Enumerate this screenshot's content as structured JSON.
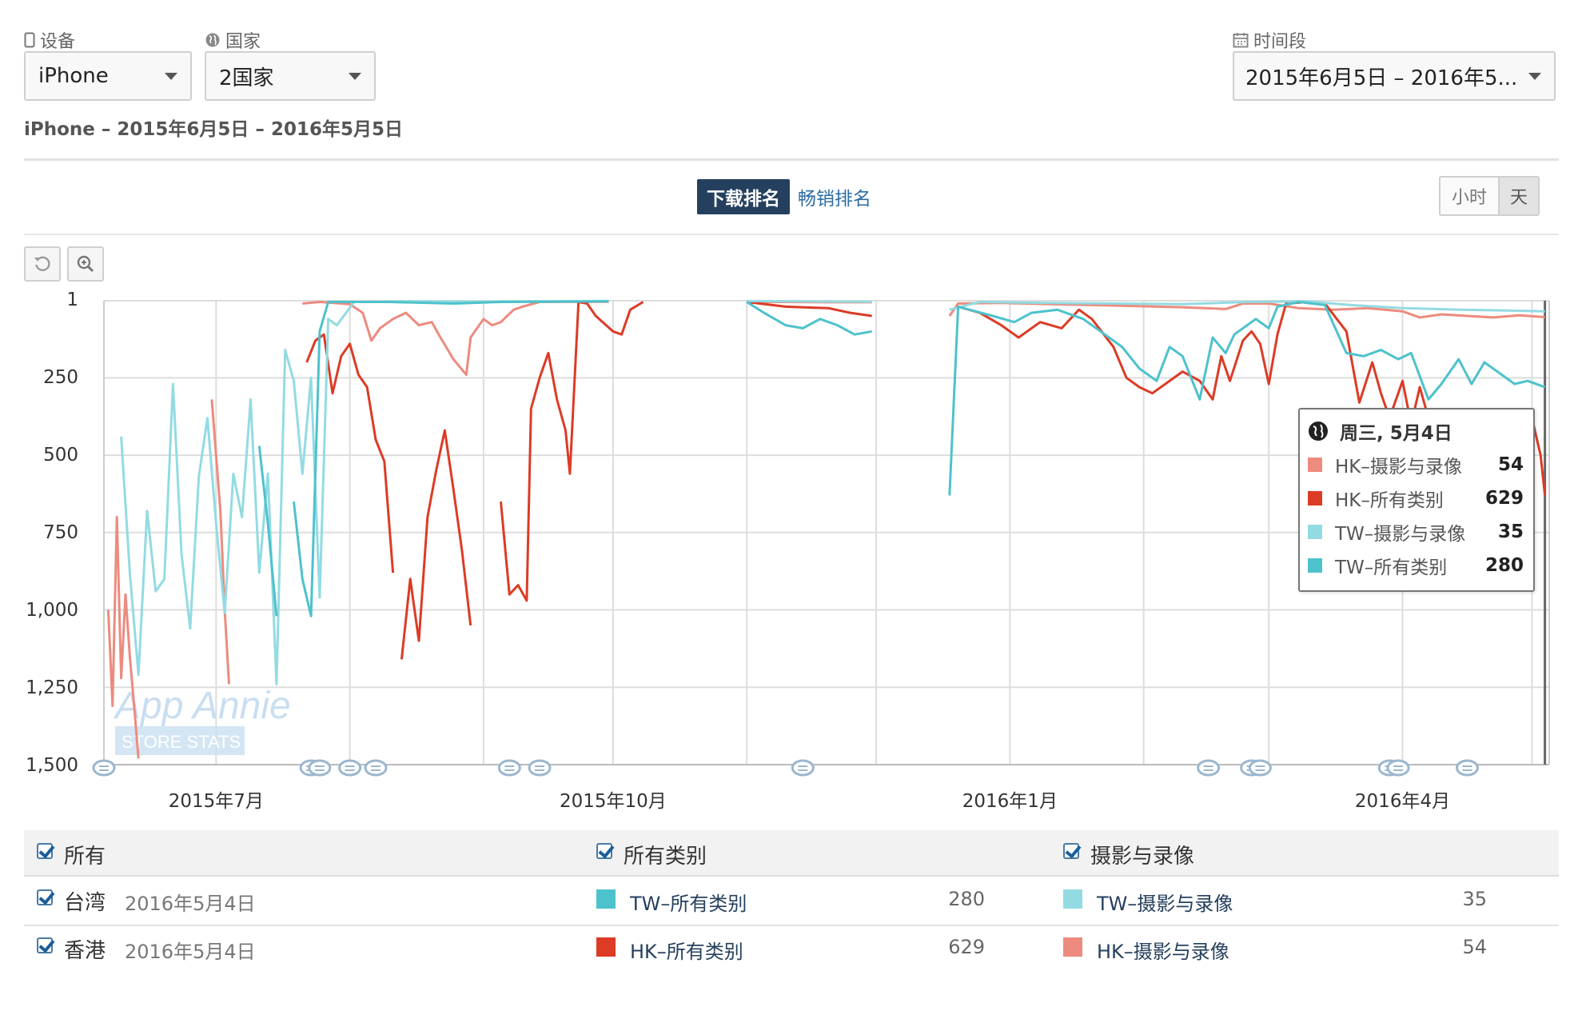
{
  "filters": {
    "device_label": "设备",
    "device_value": "iPhone",
    "country_label": "国家",
    "country_value": "2国家",
    "period_label": "时间段",
    "period_value": "2015年6月5日 – 2016年5..."
  },
  "subtitle": "iPhone – 2015年6月5日 – 2016年5月5日",
  "tabs": {
    "active": "下载排名",
    "other": "畅销排名"
  },
  "granularity": {
    "hour": "小时",
    "day": "天"
  },
  "watermark": {
    "line1": "App Annie",
    "line2": "STORE STATS"
  },
  "colors": {
    "hk_photo": "#ec8b7e",
    "hk_all": "#dc3b26",
    "tw_photo": "#93dbe2",
    "tw_all": "#4dc2cc"
  },
  "icons": {
    "device": "phone-icon",
    "country": "globe-icon",
    "period": "calendar-icon",
    "reset": "reset-icon",
    "zoom": "zoom-in-icon",
    "tooltip": "globe-icon",
    "annotation": "comment-bubble-icon"
  },
  "tooltip": {
    "date": "周三, 5月4日",
    "rows": [
      {
        "name": "HK–摄影与录像",
        "value": "54",
        "color": "#ec8b7e"
      },
      {
        "name": "HK–所有类别",
        "value": "629",
        "color": "#dc3b26"
      },
      {
        "name": "TW–摄影与录像",
        "value": "35",
        "color": "#93dbe2"
      },
      {
        "name": "TW–所有类别",
        "value": "280",
        "color": "#4dc2cc"
      }
    ]
  },
  "legend": {
    "all": "所有",
    "all_categories": "所有类别",
    "photo_video": "摄影与录像",
    "rows": [
      {
        "country": "台湾",
        "date": "2016年5月4日",
        "all_name": "TW–所有类别",
        "all_value": "280",
        "all_color": "#4dc2cc",
        "photo_name": "TW–摄影与录像",
        "photo_value": "35",
        "photo_color": "#93dbe2"
      },
      {
        "country": "香港",
        "date": "2016年5月4日",
        "all_name": "HK–所有类别",
        "all_value": "629",
        "all_color": "#dc3b26",
        "photo_name": "HK–摄影与录像",
        "photo_value": "54",
        "photo_color": "#ec8b7e"
      }
    ]
  },
  "chart_data": {
    "type": "line",
    "title": "",
    "xlabel": "",
    "ylabel": "",
    "y_reversed": true,
    "ylim": [
      1,
      1500
    ],
    "yticks": [
      1,
      250,
      500,
      750,
      1000,
      1250,
      1500
    ],
    "ytick_labels": [
      "1",
      "250",
      "500",
      "750",
      "1,000",
      "1,250",
      "1,500"
    ],
    "xlim": [
      "2015-06-05",
      "2016-05-05"
    ],
    "xticks": [
      {
        "date": "2015-07-01",
        "label": "2015年7月"
      },
      {
        "date": "2015-10-01",
        "label": "2015年10月"
      },
      {
        "date": "2016-01-01",
        "label": "2016年1月"
      },
      {
        "date": "2016-04-01",
        "label": "2016年4月"
      }
    ],
    "grid": true,
    "annotation_dates": [
      "2015-06-05",
      "2015-07-23",
      "2015-07-25",
      "2015-08-01",
      "2015-08-07",
      "2015-09-07",
      "2015-09-14",
      "2015-11-14",
      "2016-02-16",
      "2016-02-26",
      "2016-02-28",
      "2016-03-29",
      "2016-03-31",
      "2016-04-16"
    ],
    "series": [
      {
        "name": "HK–摄影与录像",
        "color": "#ec8b7e",
        "points": [
          [
            "2015-06-06",
            1000
          ],
          [
            "2015-06-07",
            1310
          ],
          [
            "2015-06-08",
            700
          ],
          [
            "2015-06-09",
            1220
          ],
          [
            "2015-06-10",
            950
          ],
          [
            "2015-06-11",
            1150
          ],
          [
            "2015-06-12",
            1310
          ],
          [
            "2015-06-13",
            1480
          ],
          null,
          [
            "2015-06-30",
            320
          ],
          [
            "2015-07-02",
            680
          ],
          [
            "2015-07-03",
            1000
          ],
          [
            "2015-07-04",
            1240
          ],
          null,
          [
            "2015-07-21",
            10
          ],
          [
            "2015-07-25",
            5
          ],
          [
            "2015-08-01",
            12
          ],
          [
            "2015-08-04",
            40
          ],
          [
            "2015-08-06",
            130
          ],
          [
            "2015-08-08",
            90
          ],
          [
            "2015-08-11",
            60
          ],
          [
            "2015-08-14",
            40
          ],
          [
            "2015-08-17",
            80
          ],
          [
            "2015-08-20",
            70
          ],
          [
            "2015-08-22",
            120
          ],
          [
            "2015-08-25",
            190
          ],
          [
            "2015-08-28",
            240
          ],
          [
            "2015-08-29",
            120
          ],
          [
            "2015-09-01",
            60
          ],
          [
            "2015-09-03",
            80
          ],
          [
            "2015-09-05",
            70
          ],
          [
            "2015-09-08",
            30
          ],
          [
            "2015-09-10",
            20
          ],
          [
            "2015-09-14",
            5
          ],
          [
            "2015-09-30",
            4
          ],
          null,
          [
            "2015-11-01",
            5
          ],
          [
            "2015-11-10",
            5
          ],
          [
            "2015-11-20",
            6
          ],
          [
            "2015-11-30",
            6
          ],
          null,
          [
            "2015-12-18",
            50
          ],
          [
            "2015-12-20",
            10
          ],
          [
            "2015-12-30",
            8
          ],
          [
            "2016-01-10",
            12
          ],
          [
            "2016-01-20",
            15
          ],
          [
            "2016-01-30",
            18
          ],
          [
            "2016-02-10",
            22
          ],
          [
            "2016-02-20",
            28
          ],
          [
            "2016-02-24",
            10
          ],
          [
            "2016-03-01",
            10
          ],
          [
            "2016-03-08",
            25
          ],
          [
            "2016-03-16",
            30
          ],
          [
            "2016-03-24",
            25
          ],
          [
            "2016-04-01",
            35
          ],
          [
            "2016-04-05",
            55
          ],
          [
            "2016-04-10",
            45
          ],
          [
            "2016-04-16",
            50
          ],
          [
            "2016-04-22",
            55
          ],
          [
            "2016-04-28",
            48
          ],
          [
            "2016-05-04",
            54
          ]
        ]
      },
      {
        "name": "HK–所有类别",
        "color": "#dc3b26",
        "points": [
          [
            "2015-07-22",
            200
          ],
          [
            "2015-07-24",
            130
          ],
          [
            "2015-07-26",
            110
          ],
          [
            "2015-07-28",
            300
          ],
          [
            "2015-07-30",
            180
          ],
          [
            "2015-08-01",
            140
          ],
          [
            "2015-08-03",
            240
          ],
          [
            "2015-08-05",
            280
          ],
          [
            "2015-08-07",
            450
          ],
          [
            "2015-08-09",
            520
          ],
          [
            "2015-08-11",
            880
          ],
          null,
          [
            "2015-08-13",
            1160
          ],
          [
            "2015-08-15",
            900
          ],
          [
            "2015-08-17",
            1100
          ],
          [
            "2015-08-19",
            700
          ],
          [
            "2015-08-21",
            550
          ],
          [
            "2015-08-23",
            420
          ],
          [
            "2015-08-25",
            610
          ],
          [
            "2015-08-27",
            810
          ],
          [
            "2015-08-29",
            1050
          ],
          null,
          [
            "2015-09-05",
            650
          ],
          [
            "2015-09-07",
            950
          ],
          [
            "2015-09-09",
            920
          ],
          [
            "2015-09-11",
            970
          ],
          [
            "2015-09-12",
            350
          ],
          [
            "2015-09-14",
            250
          ],
          [
            "2015-09-16",
            170
          ],
          [
            "2015-09-18",
            320
          ],
          [
            "2015-09-20",
            420
          ],
          [
            "2015-09-21",
            560
          ],
          [
            "2015-09-23",
            5
          ],
          [
            "2015-09-25",
            10
          ],
          [
            "2015-09-27",
            50
          ],
          [
            "2015-10-01",
            100
          ],
          [
            "2015-10-03",
            110
          ],
          [
            "2015-10-05",
            30
          ],
          [
            "2015-10-08",
            5
          ],
          null,
          [
            "2015-11-01",
            5
          ],
          [
            "2015-11-10",
            20
          ],
          [
            "2015-11-20",
            25
          ],
          [
            "2015-11-25",
            40
          ],
          [
            "2015-11-30",
            50
          ],
          null,
          [
            "2015-12-20",
            20
          ],
          [
            "2015-12-25",
            40
          ],
          [
            "2015-12-30",
            80
          ],
          [
            "2016-01-03",
            120
          ],
          [
            "2016-01-08",
            70
          ],
          [
            "2016-01-13",
            90
          ],
          [
            "2016-01-17",
            30
          ],
          [
            "2016-01-20",
            60
          ],
          [
            "2016-01-25",
            150
          ],
          [
            "2016-01-28",
            250
          ],
          [
            "2016-01-31",
            280
          ],
          [
            "2016-02-03",
            300
          ],
          [
            "2016-02-06",
            270
          ],
          [
            "2016-02-10",
            230
          ],
          [
            "2016-02-14",
            260
          ],
          [
            "2016-02-17",
            320
          ],
          [
            "2016-02-19",
            180
          ],
          [
            "2016-02-21",
            260
          ],
          [
            "2016-02-24",
            130
          ],
          [
            "2016-02-26",
            100
          ],
          [
            "2016-02-28",
            140
          ],
          [
            "2016-03-01",
            270
          ],
          [
            "2016-03-03",
            110
          ],
          [
            "2016-03-05",
            10
          ],
          [
            "2016-03-10",
            5
          ],
          [
            "2016-03-14",
            10
          ],
          [
            "2016-03-19",
            100
          ],
          [
            "2016-03-22",
            330
          ],
          [
            "2016-03-25",
            200
          ],
          [
            "2016-03-27",
            300
          ],
          [
            "2016-03-29",
            380
          ],
          [
            "2016-04-01",
            260
          ],
          [
            "2016-04-03",
            400
          ],
          [
            "2016-04-05",
            280
          ],
          [
            "2016-04-07",
            380
          ],
          null,
          [
            "2016-04-29",
            420
          ],
          [
            "2016-05-01",
            380
          ],
          [
            "2016-05-03",
            500
          ],
          [
            "2016-05-04",
            629
          ]
        ]
      },
      {
        "name": "TW–摄影与录像",
        "color": "#93dbe2",
        "points": [
          [
            "2015-06-09",
            440
          ],
          [
            "2015-06-11",
            880
          ],
          [
            "2015-06-13",
            1210
          ],
          [
            "2015-06-15",
            680
          ],
          [
            "2015-06-17",
            940
          ],
          [
            "2015-06-19",
            900
          ],
          [
            "2015-06-21",
            270
          ],
          [
            "2015-06-23",
            820
          ],
          [
            "2015-06-25",
            1060
          ],
          [
            "2015-06-27",
            570
          ],
          [
            "2015-06-29",
            380
          ],
          [
            "2015-07-01",
            720
          ],
          [
            "2015-07-03",
            1010
          ],
          [
            "2015-07-05",
            560
          ],
          [
            "2015-07-07",
            700
          ],
          [
            "2015-07-09",
            320
          ],
          [
            "2015-07-11",
            880
          ],
          [
            "2015-07-13",
            560
          ],
          [
            "2015-07-15",
            1240
          ],
          [
            "2015-07-17",
            160
          ],
          [
            "2015-07-19",
            260
          ],
          [
            "2015-07-21",
            560
          ],
          [
            "2015-07-23",
            250
          ],
          [
            "2015-07-25",
            960
          ],
          [
            "2015-07-27",
            60
          ],
          [
            "2015-07-29",
            80
          ],
          [
            "2015-08-02",
            5
          ],
          [
            "2015-08-15",
            3
          ],
          [
            "2015-09-01",
            4
          ],
          [
            "2015-09-30",
            2
          ],
          null,
          [
            "2015-11-01",
            2
          ],
          [
            "2015-11-15",
            3
          ],
          [
            "2015-11-30",
            4
          ],
          null,
          [
            "2015-12-18",
            30
          ],
          [
            "2015-12-25",
            5
          ],
          [
            "2016-01-10",
            8
          ],
          [
            "2016-02-10",
            12
          ],
          [
            "2016-02-25",
            5
          ],
          [
            "2016-03-10",
            3
          ],
          [
            "2016-03-20",
            15
          ],
          [
            "2016-04-01",
            25
          ],
          [
            "2016-04-15",
            30
          ],
          [
            "2016-05-04",
            35
          ]
        ]
      },
      {
        "name": "TW–所有类别",
        "color": "#4dc2cc",
        "points": [
          [
            "2015-07-11",
            470
          ],
          [
            "2015-07-13",
            720
          ],
          [
            "2015-07-15",
            1020
          ],
          null,
          [
            "2015-07-19",
            650
          ],
          [
            "2015-07-21",
            900
          ],
          [
            "2015-07-23",
            1020
          ],
          [
            "2015-07-25",
            100
          ],
          [
            "2015-07-27",
            5
          ],
          [
            "2015-08-10",
            5
          ],
          [
            "2015-08-25",
            10
          ],
          [
            "2015-09-05",
            5
          ],
          [
            "2015-09-30",
            3
          ],
          null,
          [
            "2015-11-01",
            5
          ],
          [
            "2015-11-05",
            40
          ],
          [
            "2015-11-10",
            80
          ],
          [
            "2015-11-14",
            90
          ],
          [
            "2015-11-18",
            60
          ],
          [
            "2015-11-22",
            80
          ],
          [
            "2015-11-26",
            110
          ],
          [
            "2015-11-30",
            100
          ],
          null,
          [
            "2015-12-18",
            630
          ],
          [
            "2015-12-20",
            20
          ],
          [
            "2015-12-28",
            50
          ],
          [
            "2016-01-02",
            70
          ],
          [
            "2016-01-06",
            40
          ],
          [
            "2016-01-12",
            30
          ],
          [
            "2016-01-18",
            60
          ],
          [
            "2016-01-22",
            100
          ],
          [
            "2016-01-27",
            150
          ],
          [
            "2016-01-31",
            220
          ],
          [
            "2016-02-04",
            260
          ],
          [
            "2016-02-07",
            150
          ],
          [
            "2016-02-10",
            180
          ],
          [
            "2016-02-14",
            320
          ],
          [
            "2016-02-17",
            120
          ],
          [
            "2016-02-20",
            170
          ],
          [
            "2016-02-22",
            110
          ],
          [
            "2016-02-25",
            80
          ],
          [
            "2016-02-27",
            60
          ],
          [
            "2016-03-01",
            90
          ],
          [
            "2016-03-03",
            20
          ],
          [
            "2016-03-08",
            5
          ],
          [
            "2016-03-14",
            15
          ],
          [
            "2016-03-19",
            170
          ],
          [
            "2016-03-23",
            180
          ],
          [
            "2016-03-27",
            160
          ],
          [
            "2016-03-31",
            190
          ],
          [
            "2016-04-03",
            170
          ],
          [
            "2016-04-07",
            320
          ],
          [
            "2016-04-10",
            270
          ],
          [
            "2016-04-14",
            190
          ],
          [
            "2016-04-17",
            270
          ],
          [
            "2016-04-20",
            200
          ],
          [
            "2016-04-23",
            230
          ],
          [
            "2016-04-27",
            270
          ],
          [
            "2016-04-30",
            260
          ],
          [
            "2016-05-04",
            280
          ]
        ]
      }
    ]
  }
}
